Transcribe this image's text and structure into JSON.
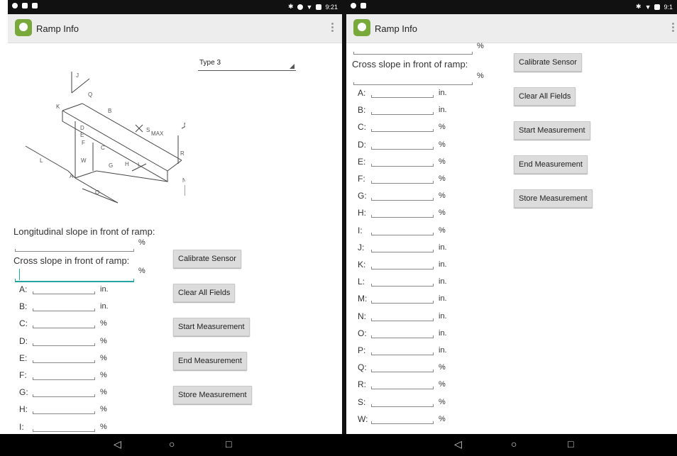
{
  "status": {
    "time_left": "9:21",
    "time_right": "9:1"
  },
  "app": {
    "title": "Ramp Info"
  },
  "spinner": {
    "value": "Type 3"
  },
  "left": {
    "longitudinal_label": "Longitudinal slope in front of ramp:",
    "cross_label": "Cross slope in front of ramp:",
    "long_unit": "%",
    "cross_unit": "%",
    "rows": [
      {
        "label": "A:",
        "unit": "in."
      },
      {
        "label": "B:",
        "unit": "in."
      },
      {
        "label": "C:",
        "unit": "%"
      },
      {
        "label": "D:",
        "unit": "%"
      },
      {
        "label": "E:",
        "unit": "%"
      },
      {
        "label": "F:",
        "unit": "%"
      },
      {
        "label": "G:",
        "unit": "%"
      },
      {
        "label": "H:",
        "unit": "%"
      },
      {
        "label": "I:",
        "unit": "%"
      }
    ]
  },
  "right": {
    "top_unit": "%",
    "cross_label": "Cross slope in front of ramp:",
    "cross_unit": "%",
    "rows": [
      {
        "label": "A:",
        "unit": "in."
      },
      {
        "label": "B:",
        "unit": "in."
      },
      {
        "label": "C:",
        "unit": "%"
      },
      {
        "label": "D:",
        "unit": "%"
      },
      {
        "label": "E:",
        "unit": "%"
      },
      {
        "label": "F:",
        "unit": "%"
      },
      {
        "label": "G:",
        "unit": "%"
      },
      {
        "label": "H:",
        "unit": "%"
      },
      {
        "label": "I:",
        "unit": "%"
      },
      {
        "label": "J:",
        "unit": "in."
      },
      {
        "label": "K:",
        "unit": "in."
      },
      {
        "label": "L:",
        "unit": "in."
      },
      {
        "label": "M:",
        "unit": "in."
      },
      {
        "label": "N:",
        "unit": "in."
      },
      {
        "label": "O:",
        "unit": "in."
      },
      {
        "label": "P:",
        "unit": "in."
      },
      {
        "label": "Q:",
        "unit": "%"
      },
      {
        "label": "R:",
        "unit": "%"
      },
      {
        "label": "S:",
        "unit": "%"
      },
      {
        "label": "W:",
        "unit": "%"
      }
    ]
  },
  "buttons": {
    "calibrate": "Calibrate Sensor",
    "clear": "Clear All Fields",
    "start": "Start Measurement",
    "end": "End Measurement",
    "store": "Store Measurement"
  },
  "diagram_labels": {
    "j": "J",
    "q": "Q",
    "b": "B",
    "k": "K",
    "m": "M",
    "s": "S",
    "max": "MAX",
    "d": "D",
    "e": "E",
    "f": "F",
    "c": "C",
    "w": "W",
    "g": "G",
    "h": "H",
    "i": "I",
    "r": "R",
    "l": "L",
    "a": "A",
    "n": "N",
    "o": "O"
  },
  "nav": {
    "back": "◁",
    "home": "○",
    "recents": "□"
  },
  "colors": {
    "accent": "#26a3a3",
    "appbar": "#ededed",
    "button": "#dcdcdc",
    "app_icon": "#79a83b"
  }
}
